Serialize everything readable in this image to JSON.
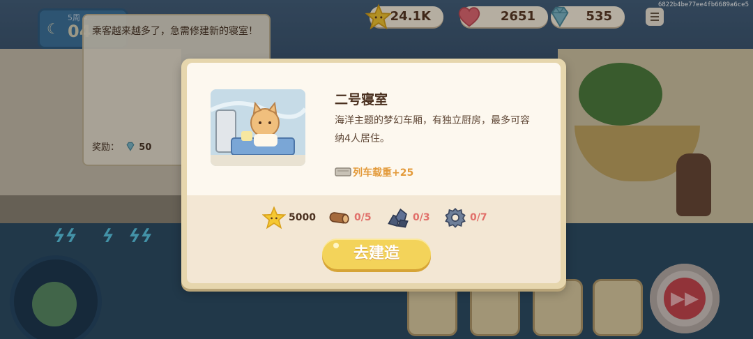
{
  "hud": {
    "stars": "24.1K",
    "hearts": "2651",
    "gems": "535",
    "device_id": "6822b4be77ee4fb6689a6ce5",
    "colors": {
      "star": "#f5c832",
      "heart": "#e46a74",
      "gem": "#7fb9c9"
    }
  },
  "week": {
    "label": "5周 4…",
    "value": "04"
  },
  "tooltip": {
    "message": "乘客越来越多了，急需修建新的寝室！",
    "reward_label": "奖励：",
    "reward_icon": "gem-icon",
    "reward_value": "50"
  },
  "modal": {
    "room_title": "二号寝室",
    "room_description": "海洋主题的梦幻车厢，有独立厨房，最多可容纳4人居住。",
    "bonus_icon": "cart-icon",
    "bonus_text": "列车载重+25",
    "requirements": [
      {
        "icon": "star-icon",
        "text": "5000",
        "status": "ok"
      },
      {
        "icon": "wood-log-icon",
        "text": "0/5",
        "status": "insufficient"
      },
      {
        "icon": "stone-icon",
        "text": "0/3",
        "status": "insufficient"
      },
      {
        "icon": "gear-icon",
        "text": "0/7",
        "status": "insufficient"
      }
    ],
    "build_button": "去建造",
    "colors": {
      "button": "#f3d35a",
      "insufficient": "#e1706a",
      "bonus": "#e39a3a"
    }
  }
}
